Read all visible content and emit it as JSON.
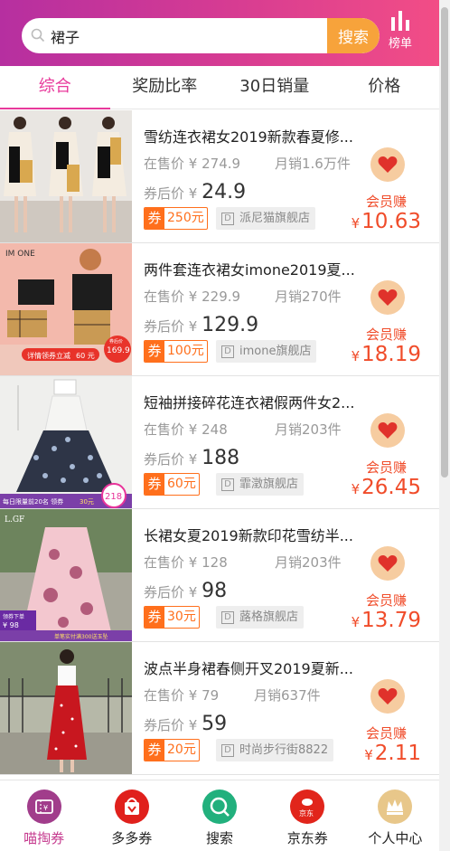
{
  "header": {
    "search_value": "裙子",
    "search_button": "搜索",
    "rank_label": "榜单"
  },
  "tabs": [
    {
      "label": "综合",
      "active": true
    },
    {
      "label": "奖励比率",
      "active": false
    },
    {
      "label": "30日销量",
      "active": false
    },
    {
      "label": "价格",
      "active": false
    }
  ],
  "products": [
    {
      "title": "雪纺连衣裙女2019新款春夏修...",
      "price_label": "在售价",
      "price": "¥ 274.9",
      "sales": "月销1.6万件",
      "after_label": "券后价",
      "after_price_symbol": "¥",
      "after_price": "24.9",
      "coupon_tag": "券",
      "coupon": "250元",
      "shop_icon": "D",
      "shop": "派尼猫旗舰店",
      "member_label": "会员赚",
      "earn_symbol": "¥",
      "earn": "10.63"
    },
    {
      "title": "两件套连衣裙女imone2019夏...",
      "price_label": "在售价",
      "price": "¥ 229.9",
      "sales": "月销270件",
      "after_label": "券后价",
      "after_price_symbol": "¥",
      "after_price": "129.9",
      "coupon_tag": "券",
      "coupon": "100元",
      "shop_icon": "D",
      "shop": "imone旗舰店",
      "member_label": "会员赚",
      "earn_symbol": "¥",
      "earn": "18.19"
    },
    {
      "title": "短袖拼接碎花连衣裙假两件女2...",
      "price_label": "在售价",
      "price": "¥ 248",
      "sales": "月销203件",
      "after_label": "券后价",
      "after_price_symbol": "¥",
      "after_price": "188",
      "coupon_tag": "券",
      "coupon": "60元",
      "shop_icon": "D",
      "shop": "霏澂旗舰店",
      "member_label": "会员赚",
      "earn_symbol": "¥",
      "earn": "26.45"
    },
    {
      "title": "长裙女夏2019新款印花雪纺半...",
      "price_label": "在售价",
      "price": "¥ 128",
      "sales": "月销203件",
      "after_label": "券后价",
      "after_price_symbol": "¥",
      "after_price": "98",
      "coupon_tag": "券",
      "coupon": "30元",
      "shop_icon": "D",
      "shop": "蕗格旗舰店",
      "member_label": "会员赚",
      "earn_symbol": "¥",
      "earn": "13.79"
    },
    {
      "title": "波点半身裙春侧开叉2019夏新...",
      "price_label": "在售价",
      "price": "¥ 79",
      "sales": "月销637件",
      "after_label": "券后价",
      "after_price_symbol": "¥",
      "after_price": "59",
      "coupon_tag": "券",
      "coupon": "20元",
      "shop_icon": "D",
      "shop": "时尚步行街8822",
      "member_label": "会员赚",
      "earn_symbol": "¥",
      "earn": "2.11"
    }
  ],
  "thumb_texts": {
    "p2_brand": "IM ONE",
    "p2_banner": "详情领券立减",
    "p2_banner_amount": "60 元",
    "p2_badge_top": "券后价",
    "p2_badge_price": "169.9",
    "p3_banner": "每日限量前20名 领券",
    "p3_banner_amount": "30元",
    "p3_badge": "218",
    "p4_brand": "L.GF",
    "p4_corner": "领券下单",
    "p4_price": "¥ 98",
    "p4_banner": "单笔实付满300送玉坠"
  },
  "nav": [
    {
      "label": "喵掏券",
      "icon": "ticket-icon",
      "color": "#a13d8b",
      "active": true
    },
    {
      "label": "多多券",
      "icon": "pinduoduo-icon",
      "color": "#e0201c",
      "active": false
    },
    {
      "label": "搜索",
      "icon": "search-icon",
      "color": "#22b07d",
      "active": false
    },
    {
      "label": "京东券",
      "icon": "jd-icon",
      "color": "#e1251b",
      "active": false
    },
    {
      "label": "个人中心",
      "icon": "crown-icon",
      "color": "#e8c78a",
      "active": false
    },
    {
      "label_inner_jd": "京东"
    }
  ],
  "colors": {
    "accent": "#e8399b",
    "coupon": "#ff6f1c",
    "earn": "#f04c2a",
    "search_button": "#f7a33b"
  }
}
